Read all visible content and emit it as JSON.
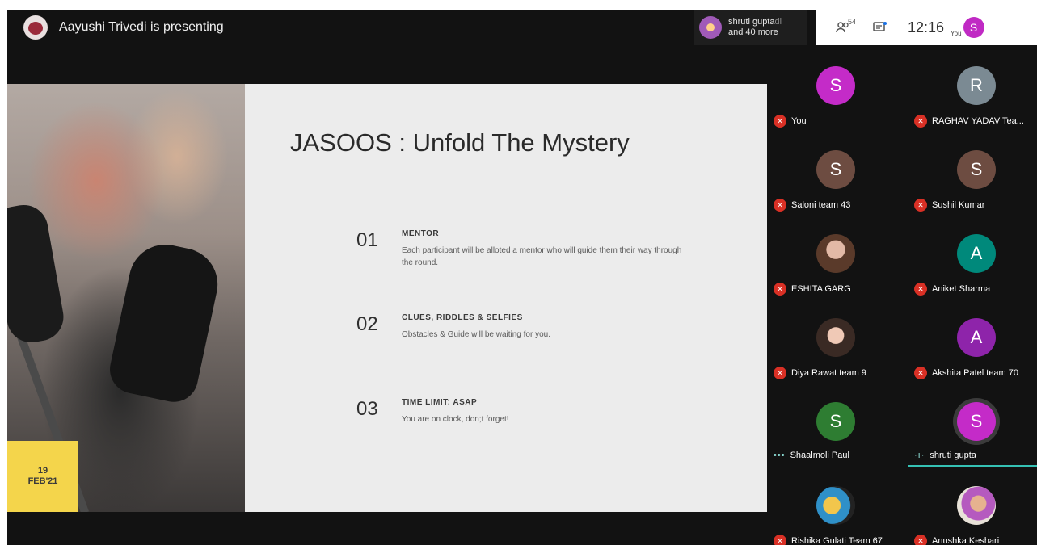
{
  "presenter": {
    "text": "Aayushi Trivedi is presenting"
  },
  "slide": {
    "title": "JASOOS : Unfold The Mystery",
    "date_day": "19",
    "date_month": "FEB'21",
    "points": [
      {
        "num": "01",
        "heading": "MENTOR",
        "desc": "Each participant will be alloted a mentor who will guide them their way through the round."
      },
      {
        "num": "02",
        "heading": "CLUES, RIDDLES & SELFIES",
        "desc": "Obstacles & Guide will be waiting for you."
      },
      {
        "num": "03",
        "heading": "TIME LIMIT: ASAP",
        "desc": "You are on clock, don;t forget!"
      }
    ]
  },
  "others_pill": {
    "name": "shruti gupta",
    "name_suffix": "di",
    "more": "and 40 more"
  },
  "toolbar": {
    "people_count": "54",
    "clock": "12:16",
    "you_label": "You",
    "me_initial": "S",
    "people_icon": "people-icon",
    "chat_icon": "chat-icon"
  },
  "participants": [
    {
      "name": "You",
      "initial": "S",
      "color": "#c42bc8",
      "muted": true
    },
    {
      "name": "RAGHAV YADAV Tea...",
      "initial": "R",
      "color": "#7b8a93",
      "muted": true
    },
    {
      "name": "Saloni team 43",
      "initial": "S",
      "color": "#6d4c41",
      "muted": true
    },
    {
      "name": "Sushil Kumar",
      "initial": "S",
      "color": "#6d4c41",
      "muted": true
    },
    {
      "name": "ESHITA GARG",
      "initial": "",
      "color": "",
      "muted": true
    },
    {
      "name": "Aniket Sharma",
      "initial": "A",
      "color": "#00897b",
      "muted": true
    },
    {
      "name": "Diya Rawat team 9",
      "initial": "",
      "color": "",
      "muted": true
    },
    {
      "name": "Akshita Patel team 70",
      "initial": "A",
      "color": "#8e24aa",
      "muted": true
    },
    {
      "name": "Shaalmoli Paul",
      "initial": "S",
      "color": "#2e7d32",
      "muted": false
    },
    {
      "name": "shruti gupta",
      "initial": "S",
      "color": "#c42bc8",
      "muted": false
    },
    {
      "name": "Rishika Gulati Team 67",
      "initial": "",
      "color": "",
      "muted": true
    },
    {
      "name": "Anushka Keshari",
      "initial": "",
      "color": "",
      "muted": true
    }
  ]
}
